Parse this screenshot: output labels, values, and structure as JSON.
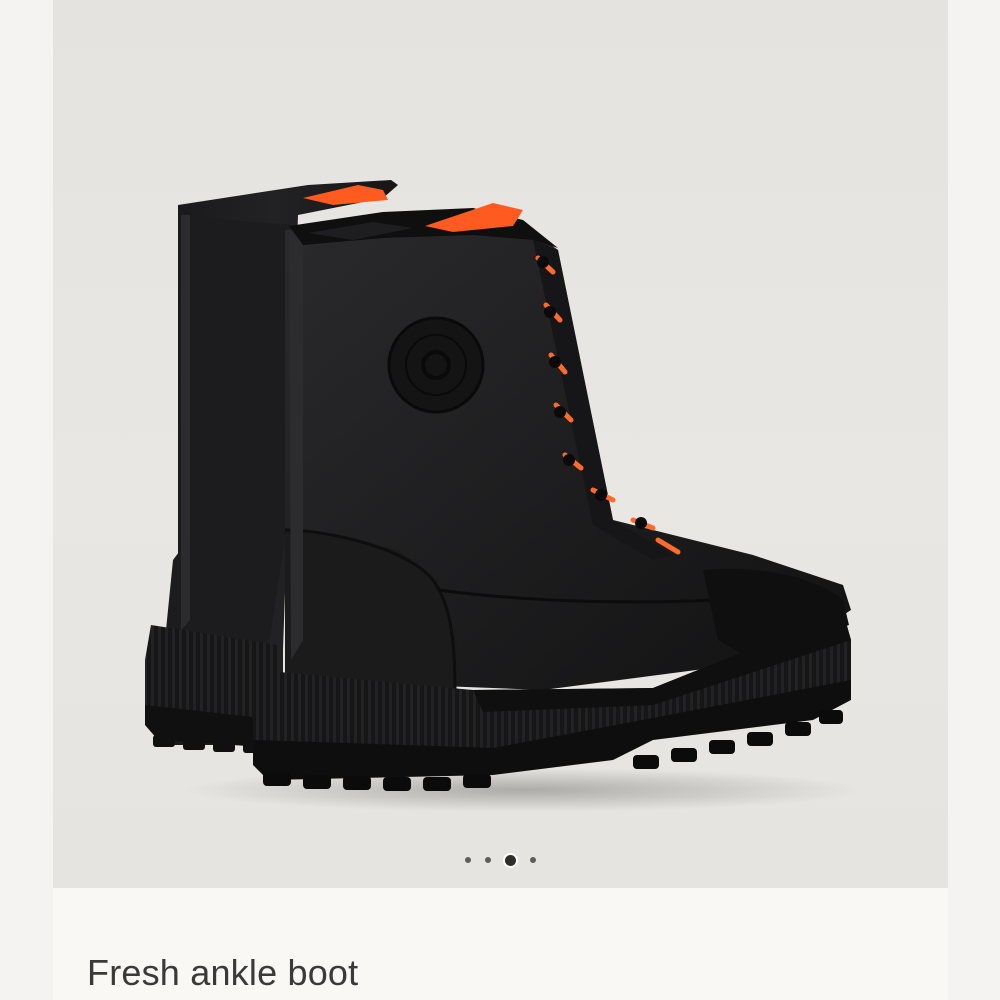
{
  "product": {
    "title": "Fresh ankle boot",
    "image_alt": "Black ankle boots with orange lining and lugged rubber soles"
  },
  "gallery": {
    "image_count": 4,
    "active_index": 2
  },
  "colors": {
    "background": "#e7e5e1",
    "boot": "#1a1a1b",
    "lining_accent": "#ff5a1f",
    "page": "#faf8f4"
  },
  "icons": [
    "hermes-seal-logo"
  ]
}
